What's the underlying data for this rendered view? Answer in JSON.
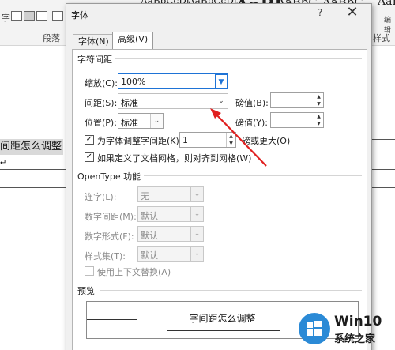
{
  "ribbon": {
    "font_size_partial": "字",
    "paragraph_label": "段落",
    "style_samples": [
      "AaBbCcDt",
      "AaBbCcDt",
      "AaBl",
      "AaBbC",
      "AaBbC",
      "AaB"
    ],
    "styles_label_partial": "样式",
    "edit_label_partial": "编辑"
  },
  "document": {
    "text_fragment": "间距怎么调整",
    "paragraph_mark": "↵"
  },
  "dialog": {
    "title": "字体",
    "help": "?",
    "close": "✕",
    "tabs": [
      {
        "label": "字体(N)"
      },
      {
        "label": "高级(V)"
      }
    ],
    "char_spacing": {
      "title": "字符间距",
      "scale_label": "缩放(C):",
      "scale_value": "100%",
      "spacing_label": "间距(S):",
      "spacing_value": "标准",
      "spacing_pt_label": "磅值(B):",
      "position_label": "位置(P):",
      "position_value": "标准",
      "position_pt_label": "磅值(Y):",
      "kerning_label": "为字体调整字间距(K):",
      "kerning_value": "1",
      "kerning_suffix": "磅或更大(O)",
      "grid_label": "如果定义了文档网格，则对齐到网格(W)"
    },
    "opentype": {
      "title": "OpenType 功能",
      "ligatures_label": "连字(L):",
      "ligatures_value": "无",
      "number_spacing_label": "数字间距(M):",
      "number_spacing_value": "默认",
      "number_forms_label": "数字形式(F):",
      "number_forms_value": "默认",
      "stylistic_sets_label": "样式集(T):",
      "stylistic_sets_value": "默认",
      "contextual_label": "使用上下文替换(A)"
    },
    "preview": {
      "title": "预览",
      "text": "字间距怎么调整"
    }
  },
  "watermark": {
    "brand": "Win10",
    "site": "系统之家"
  },
  "colors": {
    "annotation_arrow": "#e02020",
    "focus_blue": "#1e73d6",
    "logo_blue": "#2b8ad6"
  }
}
